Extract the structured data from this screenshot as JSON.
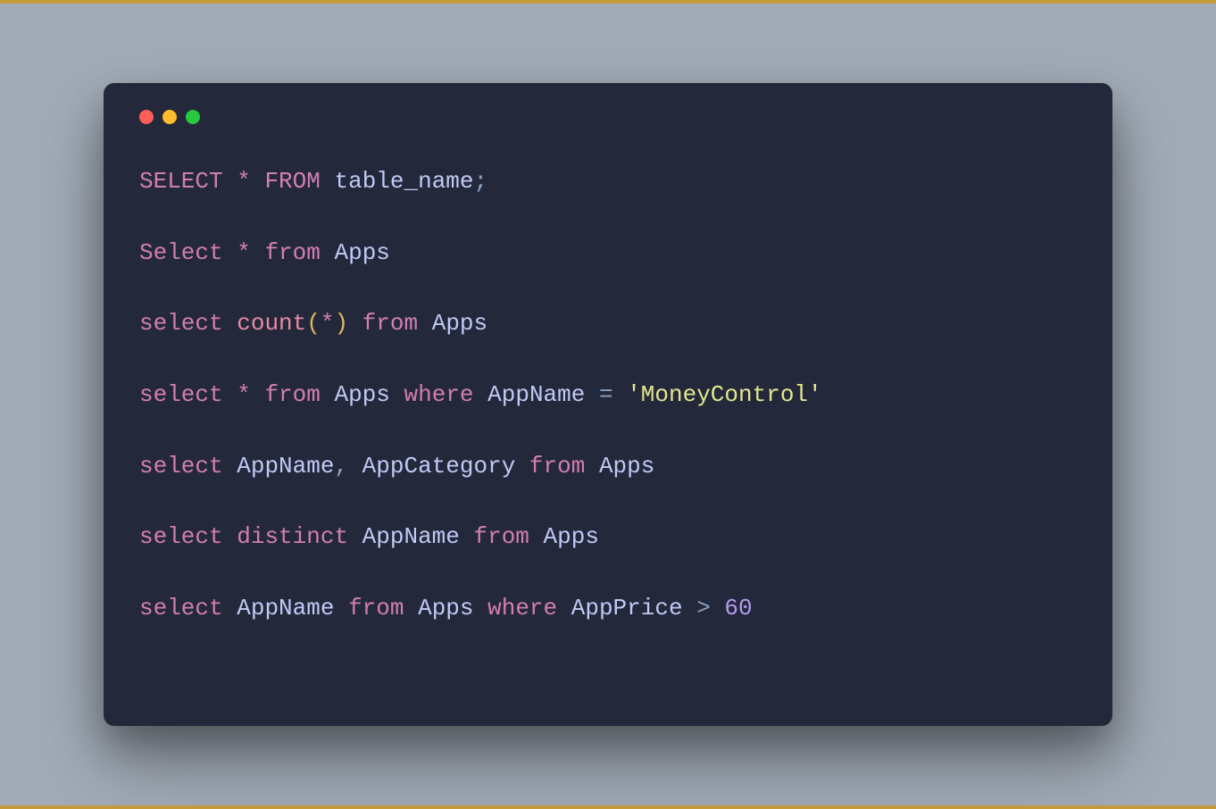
{
  "window": {
    "dots": [
      "red",
      "yellow",
      "green"
    ]
  },
  "colors": {
    "background": "#a2acb8",
    "card": "#24283b",
    "keyword": "#d27eb3",
    "identifier": "#c0caf5",
    "function": "#e88aa5",
    "paren": "#e0b862",
    "string": "#e3e88d",
    "number": "#b39cf0",
    "punct": "#8aa3c4"
  },
  "code": {
    "lines": [
      [
        {
          "t": "SELECT",
          "c": "t-kw"
        },
        {
          "t": " ",
          "c": "t-id"
        },
        {
          "t": "*",
          "c": "t-star"
        },
        {
          "t": " ",
          "c": "t-id"
        },
        {
          "t": "FROM",
          "c": "t-kw"
        },
        {
          "t": " ",
          "c": "t-id"
        },
        {
          "t": "table_name",
          "c": "t-id"
        },
        {
          "t": ";",
          "c": "t-semi"
        }
      ],
      [
        {
          "t": "Select",
          "c": "t-kw"
        },
        {
          "t": " ",
          "c": "t-id"
        },
        {
          "t": "*",
          "c": "t-star"
        },
        {
          "t": " ",
          "c": "t-id"
        },
        {
          "t": "from",
          "c": "t-kw"
        },
        {
          "t": " ",
          "c": "t-id"
        },
        {
          "t": "Apps",
          "c": "t-id"
        }
      ],
      [
        {
          "t": "select",
          "c": "t-kw"
        },
        {
          "t": " ",
          "c": "t-id"
        },
        {
          "t": "count",
          "c": "t-func"
        },
        {
          "t": "(",
          "c": "t-paren"
        },
        {
          "t": "*",
          "c": "t-star"
        },
        {
          "t": ")",
          "c": "t-paren"
        },
        {
          "t": " ",
          "c": "t-id"
        },
        {
          "t": "from",
          "c": "t-kw"
        },
        {
          "t": " ",
          "c": "t-id"
        },
        {
          "t": "Apps",
          "c": "t-id"
        }
      ],
      [
        {
          "t": "select",
          "c": "t-kw"
        },
        {
          "t": " ",
          "c": "t-id"
        },
        {
          "t": "*",
          "c": "t-star"
        },
        {
          "t": " ",
          "c": "t-id"
        },
        {
          "t": "from",
          "c": "t-kw"
        },
        {
          "t": " ",
          "c": "t-id"
        },
        {
          "t": "Apps",
          "c": "t-id"
        },
        {
          "t": " ",
          "c": "t-id"
        },
        {
          "t": "where",
          "c": "t-kw"
        },
        {
          "t": " ",
          "c": "t-id"
        },
        {
          "t": "AppName",
          "c": "t-id"
        },
        {
          "t": " ",
          "c": "t-id"
        },
        {
          "t": "=",
          "c": "t-op"
        },
        {
          "t": " ",
          "c": "t-id"
        },
        {
          "t": "'MoneyControl'",
          "c": "t-str"
        }
      ],
      [
        {
          "t": "select",
          "c": "t-kw"
        },
        {
          "t": " ",
          "c": "t-id"
        },
        {
          "t": "AppName",
          "c": "t-id"
        },
        {
          "t": ",",
          "c": "t-punc"
        },
        {
          "t": " ",
          "c": "t-id"
        },
        {
          "t": "AppCategory",
          "c": "t-id"
        },
        {
          "t": " ",
          "c": "t-id"
        },
        {
          "t": "from",
          "c": "t-kw"
        },
        {
          "t": " ",
          "c": "t-id"
        },
        {
          "t": "Apps",
          "c": "t-id"
        }
      ],
      [
        {
          "t": "select",
          "c": "t-kw"
        },
        {
          "t": " ",
          "c": "t-id"
        },
        {
          "t": "distinct",
          "c": "t-kw"
        },
        {
          "t": " ",
          "c": "t-id"
        },
        {
          "t": "AppName",
          "c": "t-id"
        },
        {
          "t": " ",
          "c": "t-id"
        },
        {
          "t": "from",
          "c": "t-kw"
        },
        {
          "t": " ",
          "c": "t-id"
        },
        {
          "t": "Apps",
          "c": "t-id"
        }
      ],
      [
        {
          "t": "select",
          "c": "t-kw"
        },
        {
          "t": " ",
          "c": "t-id"
        },
        {
          "t": "AppName",
          "c": "t-id"
        },
        {
          "t": " ",
          "c": "t-id"
        },
        {
          "t": "from",
          "c": "t-kw"
        },
        {
          "t": " ",
          "c": "t-id"
        },
        {
          "t": "Apps",
          "c": "t-id"
        },
        {
          "t": " ",
          "c": "t-id"
        },
        {
          "t": "where",
          "c": "t-kw"
        },
        {
          "t": " ",
          "c": "t-id"
        },
        {
          "t": "AppPrice",
          "c": "t-id"
        },
        {
          "t": " ",
          "c": "t-id"
        },
        {
          "t": ">",
          "c": "t-op"
        },
        {
          "t": " ",
          "c": "t-id"
        },
        {
          "t": "60",
          "c": "t-num"
        }
      ]
    ]
  }
}
